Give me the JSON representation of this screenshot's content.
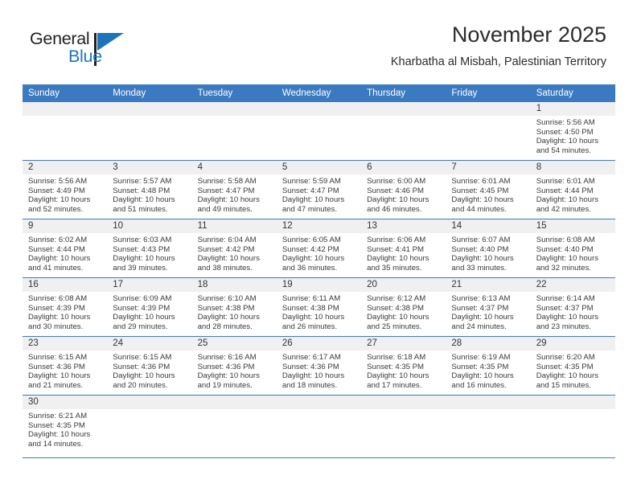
{
  "brand": {
    "name_part1": "General",
    "name_part2": "Blue",
    "accent_color": "#1b75bb"
  },
  "header": {
    "title": "November 2025",
    "subtitle": "Kharbatha al Misbah, Palestinian Territory"
  },
  "theme": {
    "header_blue": "#3b7ac0",
    "date_band_gray": "#f0f0f0",
    "text_color": "#3a3a3a"
  },
  "calendar": {
    "weekday_headers": [
      "Sunday",
      "Monday",
      "Tuesday",
      "Wednesday",
      "Thursday",
      "Friday",
      "Saturday"
    ],
    "weeks": [
      [
        {
          "day": "",
          "lines": []
        },
        {
          "day": "",
          "lines": []
        },
        {
          "day": "",
          "lines": []
        },
        {
          "day": "",
          "lines": []
        },
        {
          "day": "",
          "lines": []
        },
        {
          "day": "",
          "lines": []
        },
        {
          "day": "1",
          "lines": [
            "Sunrise: 5:56 AM",
            "Sunset: 4:50 PM",
            "Daylight: 10 hours",
            "and 54 minutes."
          ]
        }
      ],
      [
        {
          "day": "2",
          "lines": [
            "Sunrise: 5:56 AM",
            "Sunset: 4:49 PM",
            "Daylight: 10 hours",
            "and 52 minutes."
          ]
        },
        {
          "day": "3",
          "lines": [
            "Sunrise: 5:57 AM",
            "Sunset: 4:48 PM",
            "Daylight: 10 hours",
            "and 51 minutes."
          ]
        },
        {
          "day": "4",
          "lines": [
            "Sunrise: 5:58 AM",
            "Sunset: 4:47 PM",
            "Daylight: 10 hours",
            "and 49 minutes."
          ]
        },
        {
          "day": "5",
          "lines": [
            "Sunrise: 5:59 AM",
            "Sunset: 4:47 PM",
            "Daylight: 10 hours",
            "and 47 minutes."
          ]
        },
        {
          "day": "6",
          "lines": [
            "Sunrise: 6:00 AM",
            "Sunset: 4:46 PM",
            "Daylight: 10 hours",
            "and 46 minutes."
          ]
        },
        {
          "day": "7",
          "lines": [
            "Sunrise: 6:01 AM",
            "Sunset: 4:45 PM",
            "Daylight: 10 hours",
            "and 44 minutes."
          ]
        },
        {
          "day": "8",
          "lines": [
            "Sunrise: 6:01 AM",
            "Sunset: 4:44 PM",
            "Daylight: 10 hours",
            "and 42 minutes."
          ]
        }
      ],
      [
        {
          "day": "9",
          "lines": [
            "Sunrise: 6:02 AM",
            "Sunset: 4:44 PM",
            "Daylight: 10 hours",
            "and 41 minutes."
          ]
        },
        {
          "day": "10",
          "lines": [
            "Sunrise: 6:03 AM",
            "Sunset: 4:43 PM",
            "Daylight: 10 hours",
            "and 39 minutes."
          ]
        },
        {
          "day": "11",
          "lines": [
            "Sunrise: 6:04 AM",
            "Sunset: 4:42 PM",
            "Daylight: 10 hours",
            "and 38 minutes."
          ]
        },
        {
          "day": "12",
          "lines": [
            "Sunrise: 6:05 AM",
            "Sunset: 4:42 PM",
            "Daylight: 10 hours",
            "and 36 minutes."
          ]
        },
        {
          "day": "13",
          "lines": [
            "Sunrise: 6:06 AM",
            "Sunset: 4:41 PM",
            "Daylight: 10 hours",
            "and 35 minutes."
          ]
        },
        {
          "day": "14",
          "lines": [
            "Sunrise: 6:07 AM",
            "Sunset: 4:40 PM",
            "Daylight: 10 hours",
            "and 33 minutes."
          ]
        },
        {
          "day": "15",
          "lines": [
            "Sunrise: 6:08 AM",
            "Sunset: 4:40 PM",
            "Daylight: 10 hours",
            "and 32 minutes."
          ]
        }
      ],
      [
        {
          "day": "16",
          "lines": [
            "Sunrise: 6:08 AM",
            "Sunset: 4:39 PM",
            "Daylight: 10 hours",
            "and 30 minutes."
          ]
        },
        {
          "day": "17",
          "lines": [
            "Sunrise: 6:09 AM",
            "Sunset: 4:39 PM",
            "Daylight: 10 hours",
            "and 29 minutes."
          ]
        },
        {
          "day": "18",
          "lines": [
            "Sunrise: 6:10 AM",
            "Sunset: 4:38 PM",
            "Daylight: 10 hours",
            "and 28 minutes."
          ]
        },
        {
          "day": "19",
          "lines": [
            "Sunrise: 6:11 AM",
            "Sunset: 4:38 PM",
            "Daylight: 10 hours",
            "and 26 minutes."
          ]
        },
        {
          "day": "20",
          "lines": [
            "Sunrise: 6:12 AM",
            "Sunset: 4:38 PM",
            "Daylight: 10 hours",
            "and 25 minutes."
          ]
        },
        {
          "day": "21",
          "lines": [
            "Sunrise: 6:13 AM",
            "Sunset: 4:37 PM",
            "Daylight: 10 hours",
            "and 24 minutes."
          ]
        },
        {
          "day": "22",
          "lines": [
            "Sunrise: 6:14 AM",
            "Sunset: 4:37 PM",
            "Daylight: 10 hours",
            "and 23 minutes."
          ]
        }
      ],
      [
        {
          "day": "23",
          "lines": [
            "Sunrise: 6:15 AM",
            "Sunset: 4:36 PM",
            "Daylight: 10 hours",
            "and 21 minutes."
          ]
        },
        {
          "day": "24",
          "lines": [
            "Sunrise: 6:15 AM",
            "Sunset: 4:36 PM",
            "Daylight: 10 hours",
            "and 20 minutes."
          ]
        },
        {
          "day": "25",
          "lines": [
            "Sunrise: 6:16 AM",
            "Sunset: 4:36 PM",
            "Daylight: 10 hours",
            "and 19 minutes."
          ]
        },
        {
          "day": "26",
          "lines": [
            "Sunrise: 6:17 AM",
            "Sunset: 4:36 PM",
            "Daylight: 10 hours",
            "and 18 minutes."
          ]
        },
        {
          "day": "27",
          "lines": [
            "Sunrise: 6:18 AM",
            "Sunset: 4:35 PM",
            "Daylight: 10 hours",
            "and 17 minutes."
          ]
        },
        {
          "day": "28",
          "lines": [
            "Sunrise: 6:19 AM",
            "Sunset: 4:35 PM",
            "Daylight: 10 hours",
            "and 16 minutes."
          ]
        },
        {
          "day": "29",
          "lines": [
            "Sunrise: 6:20 AM",
            "Sunset: 4:35 PM",
            "Daylight: 10 hours",
            "and 15 minutes."
          ]
        }
      ],
      [
        {
          "day": "30",
          "lines": [
            "Sunrise: 6:21 AM",
            "Sunset: 4:35 PM",
            "Daylight: 10 hours",
            "and 14 minutes."
          ]
        },
        {
          "day": "",
          "lines": []
        },
        {
          "day": "",
          "lines": []
        },
        {
          "day": "",
          "lines": []
        },
        {
          "day": "",
          "lines": []
        },
        {
          "day": "",
          "lines": []
        },
        {
          "day": "",
          "lines": []
        }
      ]
    ]
  }
}
